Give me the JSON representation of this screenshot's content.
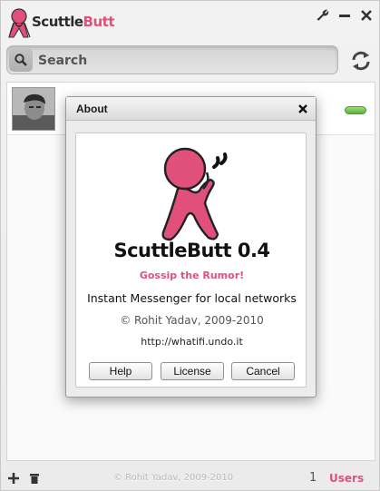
{
  "app": {
    "title_part1": "Scuttle",
    "title_part2": "Butt",
    "brand_color": "#e0507a"
  },
  "window_controls": {
    "settings_icon": "wrench-icon",
    "minimize_icon": "minimize-icon",
    "close_icon": "close-icon"
  },
  "search": {
    "placeholder": "Search",
    "icon": "search-icon",
    "refresh_icon": "refresh-icon"
  },
  "users": [
    {
      "status": "online",
      "status_color": "#6cc04a"
    }
  ],
  "bottombar": {
    "add_icon": "plus-icon",
    "delete_icon": "trash-icon",
    "copyright": "© Rohit Yadav, 2009-2010",
    "user_count": "1",
    "users_label": "Users"
  },
  "about_dialog": {
    "title": "About",
    "app_name": "ScuttleButt 0.4",
    "tagline": "Gossip the Rumor!",
    "description": "Instant Messenger for local networks",
    "copyright": "© Rohit Yadav, 2009-2010",
    "url": "http://whatifi.undo.it",
    "buttons": {
      "help": "Help",
      "license": "License",
      "cancel": "Cancel"
    }
  }
}
